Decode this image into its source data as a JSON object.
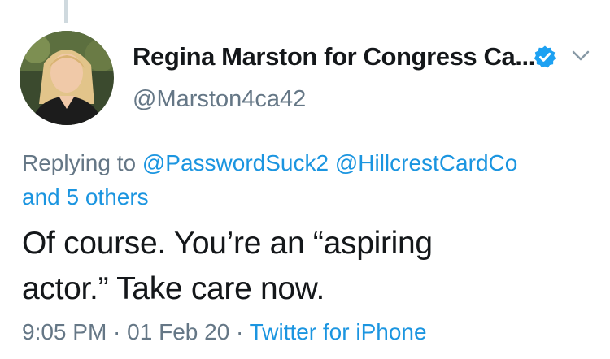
{
  "tweet": {
    "author": {
      "display_name": "Regina Marston for Congress Ca...",
      "handle": "@Marston4ca42",
      "verified_icon": "verified-badge-icon"
    },
    "reply_context": {
      "prefix": "Replying to ",
      "mention_1": "@PasswordSuck2",
      "mention_2": "@HillcrestCardCo",
      "others": "and 5 others"
    },
    "text": "Of course. You’re an “aspiring\nactor.”  Take care now.",
    "meta": {
      "time": "9:05 PM",
      "separator": " · ",
      "date": "01 Feb 20",
      "source": "Twitter for iPhone"
    }
  },
  "colors": {
    "link": "#1b95e0",
    "secondary_text": "#657786",
    "primary_text": "#14171a",
    "verified": "#1da1f2"
  }
}
